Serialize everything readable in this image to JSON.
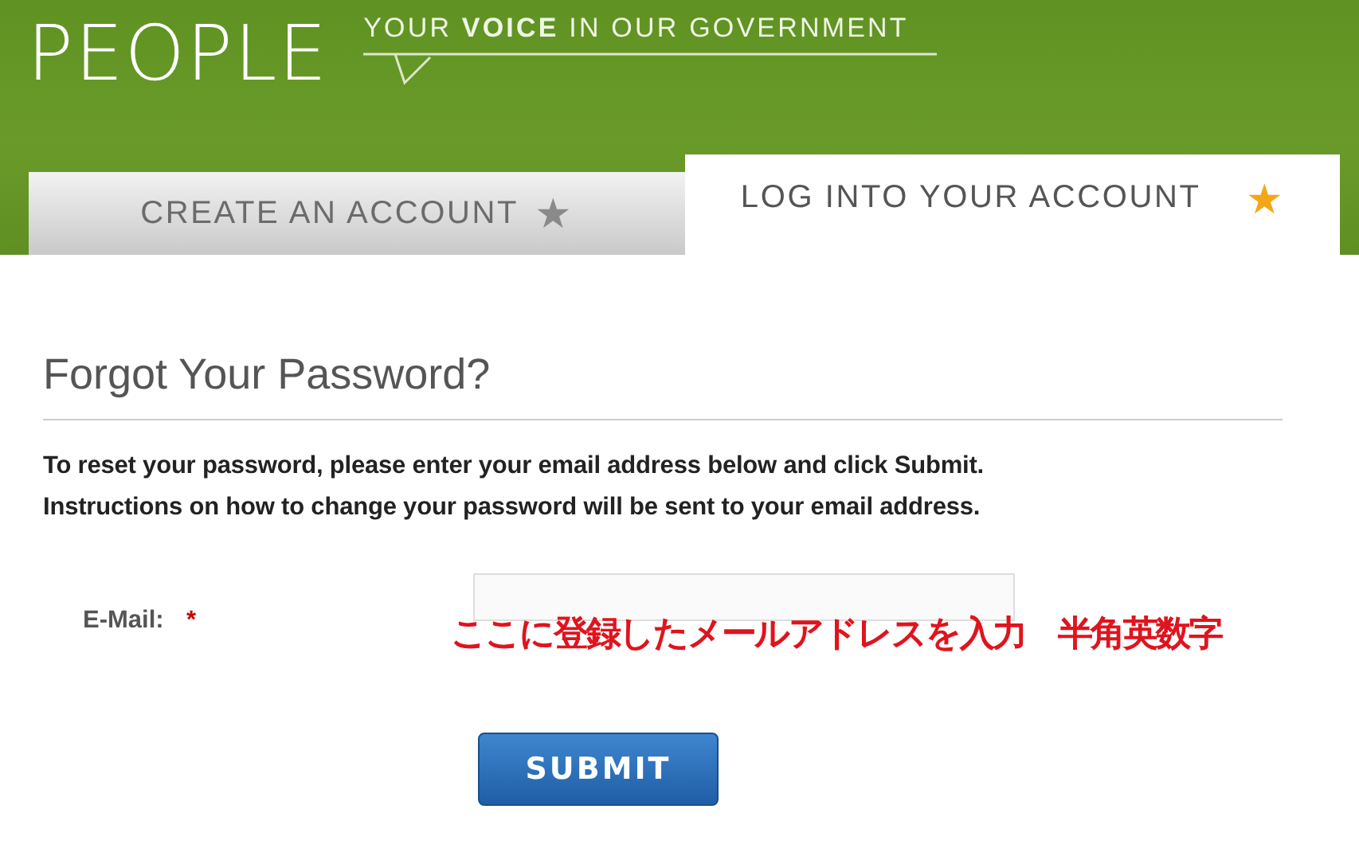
{
  "header": {
    "logo": "PEOPLE",
    "tagline": "YOUR **VOICE** IN OUR GOVERNMENT"
  },
  "tabs": [
    {
      "label": "CREATE AN ACCOUNT",
      "star": "★",
      "selected": false
    },
    {
      "label": "LOG INTO YOUR ACCOUNT",
      "star": "★",
      "selected": true
    }
  ],
  "form": {
    "title": "Forgot Your Password?",
    "instructions": [
      "To reset your password, please enter your email address below and click Submit.",
      "Instructions on how to change your password will be sent to your email address."
    ],
    "email_label": "E-Mail:",
    "required_mark": "*",
    "annotation": "ここに登録したメールアドレスを入力　半角英数字",
    "submit": "SUBMIT"
  }
}
